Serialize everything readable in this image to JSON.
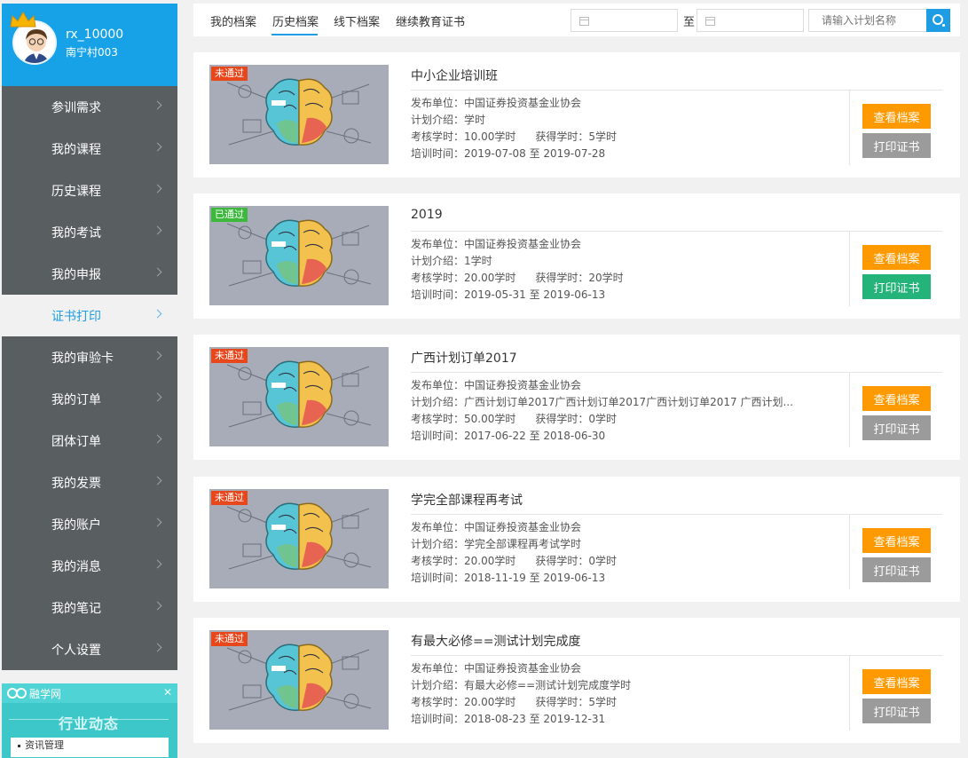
{
  "user": {
    "name": "rx_10000",
    "org": "南宁村003"
  },
  "menu": [
    {
      "label": "参训需求",
      "active": false
    },
    {
      "label": "我的课程",
      "active": false
    },
    {
      "label": "历史课程",
      "active": false
    },
    {
      "label": "我的考试",
      "active": false
    },
    {
      "label": "我的申报",
      "active": false
    },
    {
      "label": "证书打印",
      "active": true
    },
    {
      "label": "我的审验卡",
      "active": false
    },
    {
      "label": "我的订单",
      "active": false
    },
    {
      "label": "团体订单",
      "active": false
    },
    {
      "label": "我的发票",
      "active": false
    },
    {
      "label": "我的账户",
      "active": false
    },
    {
      "label": "我的消息",
      "active": false
    },
    {
      "label": "我的笔记",
      "active": false
    },
    {
      "label": "个人设置",
      "active": false
    }
  ],
  "ad": {
    "brand": "融学网",
    "title": "行业动态",
    "item": "资讯管理",
    "close": "✕"
  },
  "tabs": [
    {
      "label": "我的档案"
    },
    {
      "label": "历史档案"
    },
    {
      "label": "线下档案"
    },
    {
      "label": "继续教育证书"
    }
  ],
  "active_tab": "历史档案",
  "filter": {
    "to_label": "至",
    "search_placeholder": "请输入计划名称"
  },
  "labels": {
    "publisher": "发布单位：",
    "intro": "计划介绍：",
    "assess": "考核学时：",
    "earned": "获得学时：",
    "time": "培训时间：",
    "view_btn": "查看档案",
    "print_btn": "打印证书"
  },
  "cards": [
    {
      "status": "未通过",
      "title": "中小企业培训班",
      "publisher": "中国证券投资基金业协会",
      "intro": "学时",
      "assess": "10.00学时",
      "earned": "5学时",
      "time": "2019-07-08 至 2019-07-28"
    },
    {
      "status": "已通过",
      "title": "2019",
      "publisher": "中国证券投资基金业协会",
      "intro": "1学时",
      "assess": "20.00学时",
      "earned": "20学时",
      "time": "2019-05-31 至 2019-06-13"
    },
    {
      "status": "未通过",
      "title": "广西计划订单2017",
      "publisher": "中国证券投资基金业协会",
      "intro": "广西计划订单2017广西计划订单2017广西计划订单2017 广西计划...",
      "assess": "50.00学时",
      "earned": "0学时",
      "time": "2017-06-22 至 2018-06-30"
    },
    {
      "status": "未通过",
      "title": "学完全部课程再考试",
      "publisher": "中国证券投资基金业协会",
      "intro": "学完全部课程再考试学时",
      "assess": "20.00学时",
      "earned": "0学时",
      "time": "2018-11-19 至 2019-06-13"
    },
    {
      "status": "未通过",
      "title": "有最大必修==测试计划完成度",
      "publisher": "中国证券投资基金业协会",
      "intro": "有最大必修==测试计划完成度学时",
      "assess": "20.00学时",
      "earned": "5学时",
      "time": "2018-08-23 至 2019-12-31"
    }
  ],
  "colors": {
    "accent": "#1e9de5",
    "sidebar": "#595e60",
    "orange": "#ff9900",
    "green": "#24b47a",
    "fail": "#e8471c",
    "pass": "#3cb83c"
  }
}
